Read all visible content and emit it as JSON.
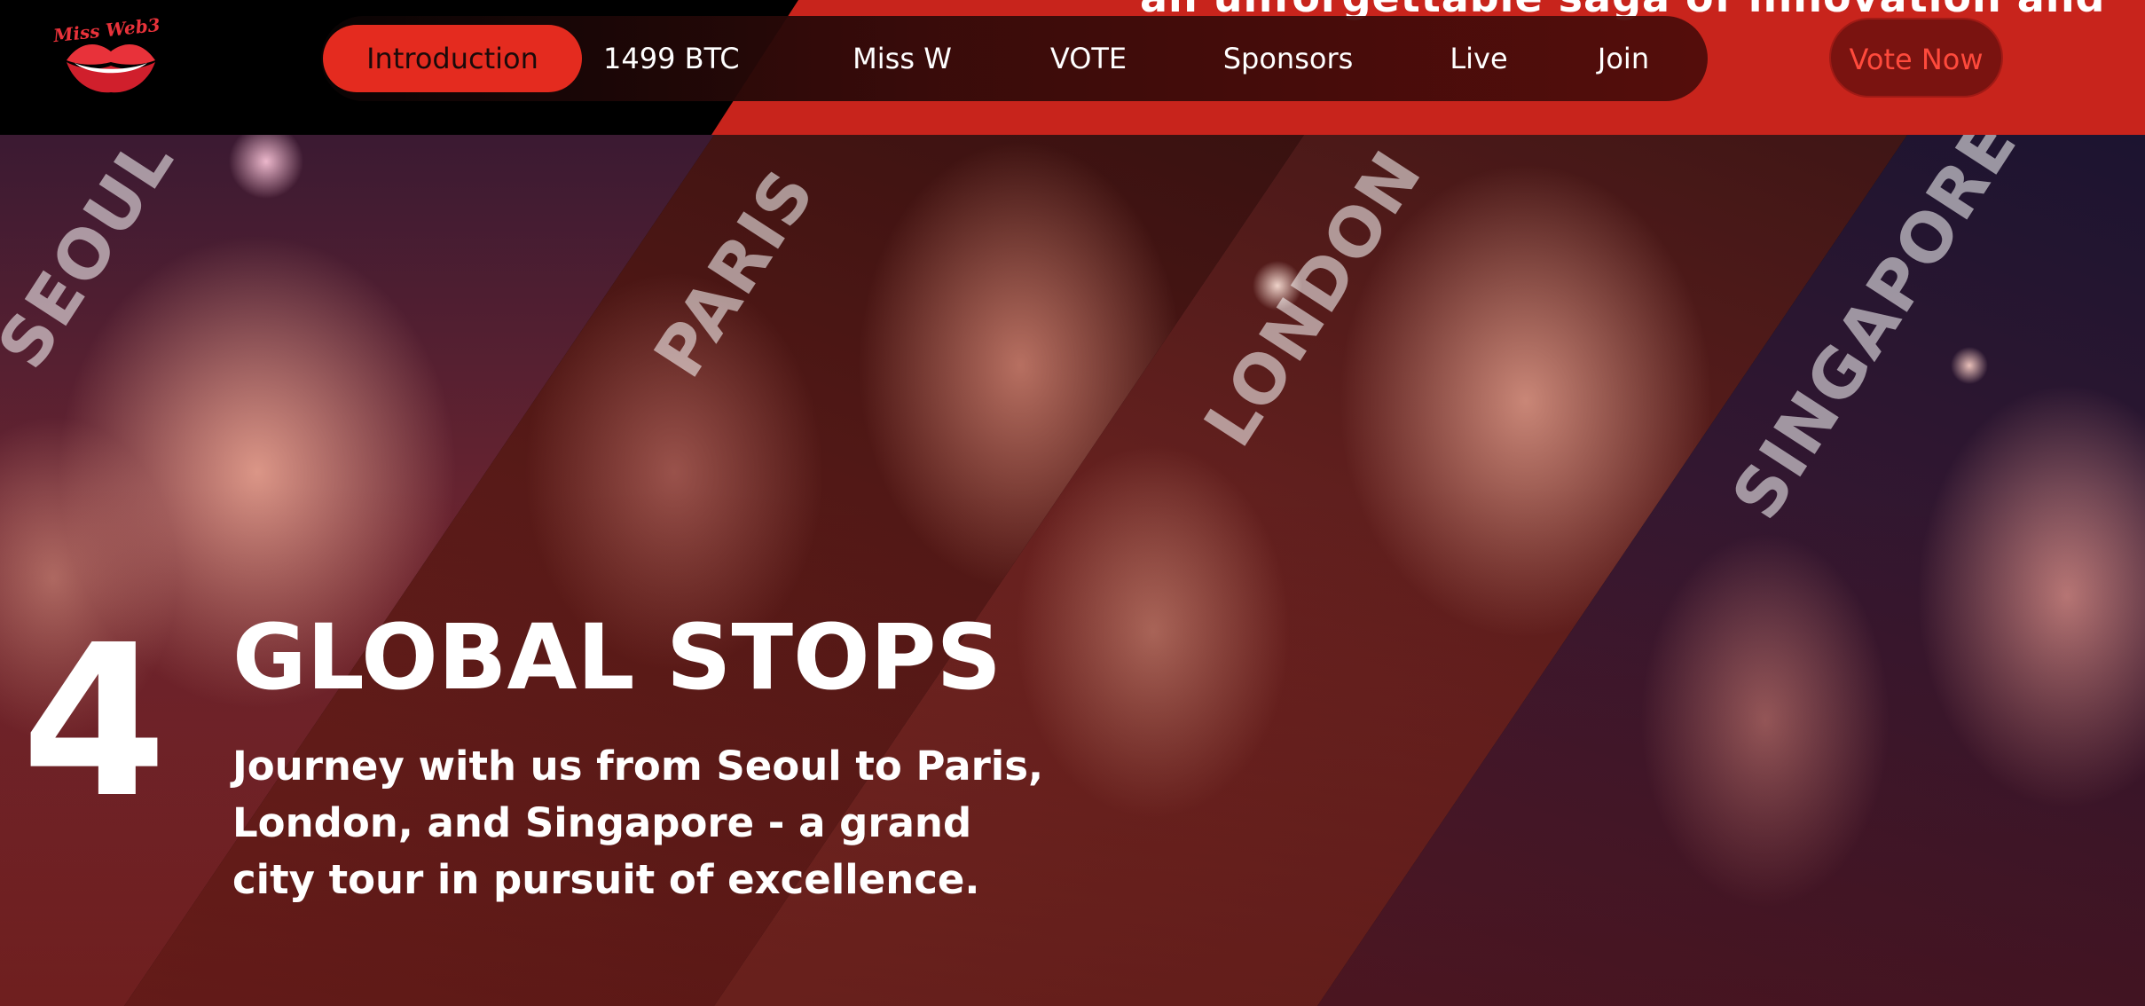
{
  "header": {
    "logo_text": "Miss Web3",
    "ticker_text": "an unforgettable saga of innovation and",
    "nav": [
      {
        "label": "Introduction",
        "active": true
      },
      {
        "label": "1499 BTC",
        "active": false
      },
      {
        "label": "Miss W",
        "active": false
      },
      {
        "label": "VOTE",
        "active": false
      },
      {
        "label": "Sponsors",
        "active": false
      },
      {
        "label": "Live",
        "active": false
      },
      {
        "label": "Join",
        "active": false
      }
    ],
    "cta_label": "Vote Now"
  },
  "hero": {
    "cities": [
      "SEOUL",
      "PARIS",
      "LONDON",
      "SINGAPORE"
    ],
    "stops_number": "4",
    "title": "GLOBAL STOPS",
    "description": "Journey with us from Seoul to Paris, London, and Singapore - a grand city tour in pursuit of excellence."
  },
  "colors": {
    "accent_red": "#e42b1f",
    "header_red": "#c8241c",
    "cta_text": "#ff4a3c"
  }
}
